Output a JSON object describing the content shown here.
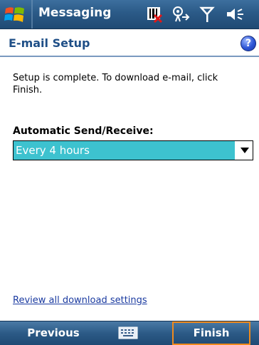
{
  "titlebar": {
    "app_title": "Messaging"
  },
  "header": {
    "title": "E-mail Setup",
    "help_glyph": "?"
  },
  "body": {
    "message": "Setup is complete.  To download e-mail, click Finish.",
    "auto_label": "Automatic Send/Receive:",
    "auto_value": "Every 4 hours",
    "review_link": "Review all download settings"
  },
  "softkeys": {
    "left": "Previous",
    "right": "Finish"
  },
  "icons": {
    "start": "windows-start-icon",
    "status": [
      "sim-missing-icon",
      "data-connection-icon",
      "signal-icon",
      "volume-icon"
    ],
    "keyboard": "keyboard-icon",
    "help": "help-icon",
    "dropdown": "chevron-down-icon"
  },
  "colors": {
    "titlebar": "#2b5a87",
    "header_text": "#1f4f87",
    "selection": "#3dc2cf",
    "softkey_highlight": "#f08a1c",
    "link": "#1a3aa0"
  }
}
